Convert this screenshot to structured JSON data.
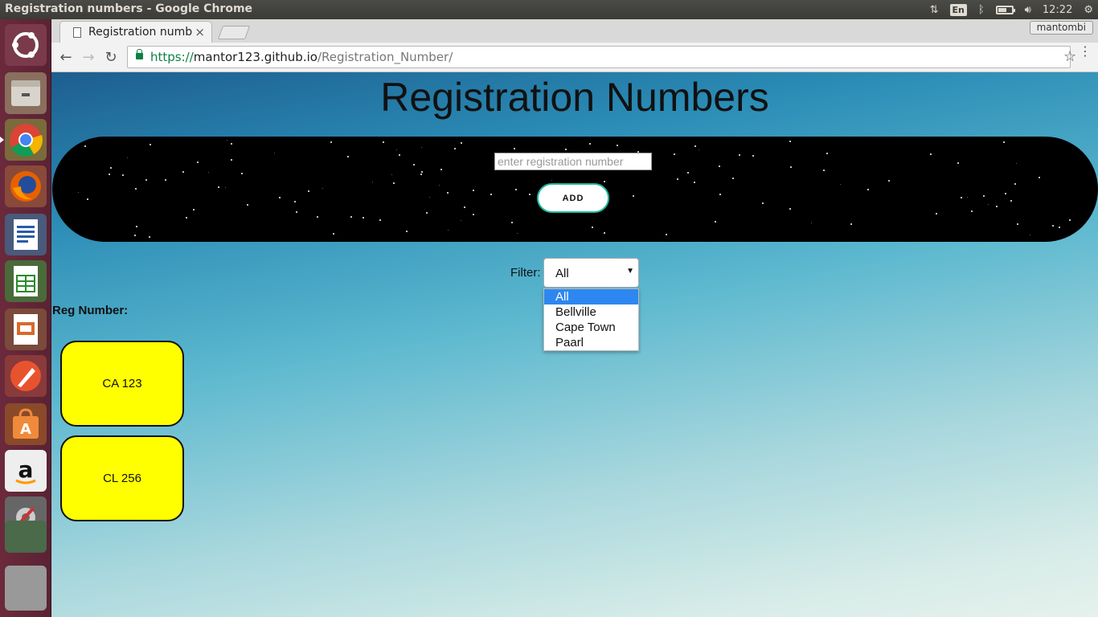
{
  "system": {
    "window_title": "Registration numbers - Google Chrome",
    "keyboard_lang": "En",
    "clock": "12:22"
  },
  "browser": {
    "tab_title": "Registration numbers",
    "tab_close": "×",
    "profile_name": "mantombi",
    "url_scheme": "https://",
    "url_host": "mantor123.github.io",
    "url_path": "/Registration_Number/",
    "back": "←",
    "forward": "→",
    "reload": "↻",
    "bookmark": "☆",
    "menu": "⋮"
  },
  "page": {
    "title": "Registration Numbers",
    "input_placeholder": "enter registration number",
    "add_button": "ADD",
    "filter_label": "Filter:",
    "filter_selected": "All",
    "filter_options": [
      "All",
      "Bellville",
      "Cape Town",
      "Paarl"
    ],
    "reg_label": "Reg Number:",
    "plates": [
      "CA 123",
      "CL 256"
    ]
  },
  "launcher_icons": [
    "ubuntu-icon",
    "files-icon",
    "chrome-icon",
    "firefox-icon",
    "writer-icon",
    "calc-icon",
    "impress-icon",
    "inkscape-icon",
    "software-center-icon",
    "amazon-icon",
    "settings-icon",
    "workspace-switcher-icon",
    "trash-icon"
  ],
  "colors": {
    "accent_button_border": "#1fb89e",
    "plate_fill": "#ffff00",
    "select_highlight": "#2e87f0"
  }
}
